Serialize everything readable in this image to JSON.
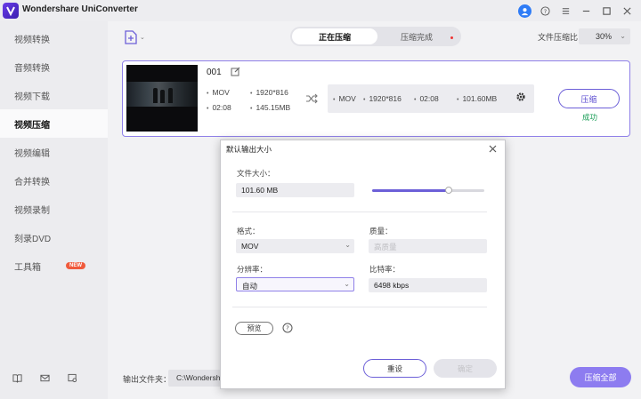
{
  "app": {
    "title": "Wondershare UniConverter",
    "accent": "#6c5fd8"
  },
  "titlebar_icons": [
    "user-icon",
    "help-icon",
    "menu-icon",
    "minimize-icon",
    "maximize-icon",
    "close-icon"
  ],
  "sidebar": {
    "items": [
      {
        "label": "视频转换",
        "active": false
      },
      {
        "label": "音频转换",
        "active": false
      },
      {
        "label": "视频下载",
        "active": false
      },
      {
        "label": "视频压缩",
        "active": true
      },
      {
        "label": "视频编辑",
        "active": false
      },
      {
        "label": "合并转换",
        "active": false
      },
      {
        "label": "视频录制",
        "active": false
      },
      {
        "label": "刻录DVD",
        "active": false
      },
      {
        "label": "工具箱",
        "active": false,
        "badge": "NEW"
      }
    ],
    "bottom_icons": [
      "book-icon",
      "mail-icon",
      "feedback-icon"
    ]
  },
  "toolbar": {
    "tabs": [
      {
        "label": "正在压缩",
        "active": true
      },
      {
        "label": "压缩完成",
        "active": false,
        "dot": true
      }
    ],
    "ratio_label": "文件压缩比",
    "ratio_value": "30%"
  },
  "file": {
    "name": "001",
    "source": {
      "format": "MOV",
      "resolution": "1920*816",
      "duration": "02:08",
      "size": "145.15MB"
    },
    "target": {
      "format": "MOV",
      "resolution": "1920*816",
      "duration": "02:08",
      "size": "101.60MB"
    },
    "compress_label": "压缩",
    "status": "成功"
  },
  "bottom": {
    "output_label": "输出文件夹：",
    "output_path": "C:\\Wondershare",
    "compress_all_label": "压缩全部"
  },
  "dialog": {
    "title": "默认输出大小",
    "size_label": "文件大小：",
    "size_value": "101.60 MB",
    "size_fraction": 0.68,
    "format_label": "格式：",
    "format_value": "MOV",
    "quality_label": "质量：",
    "quality_value": "高质量",
    "resolution_label": "分辨率：",
    "resolution_value": "自动",
    "bitrate_label": "比特率：",
    "bitrate_value": "6498 kbps",
    "preview_label": "预览",
    "reset_label": "重设",
    "ok_label": "确定"
  }
}
